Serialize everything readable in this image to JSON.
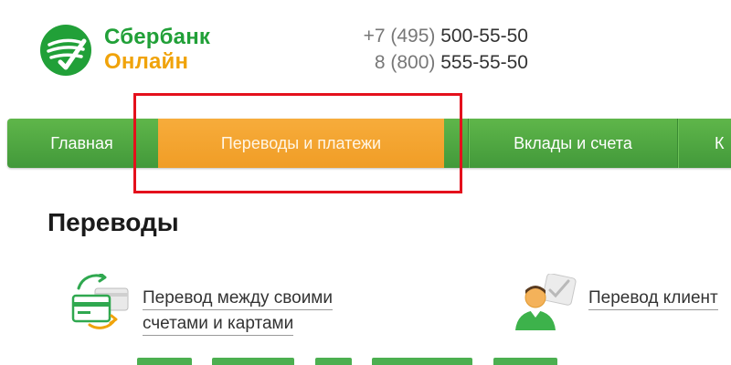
{
  "header": {
    "logo_line1": "Сбербанк",
    "logo_line2": "Онлайн",
    "phones": [
      {
        "code": "+7 (495)",
        "number": "500-55-50"
      },
      {
        "code": "8 (800)",
        "number": "555-55-50"
      }
    ]
  },
  "nav": {
    "items": [
      {
        "label": "Главная",
        "active": false
      },
      {
        "label": "Переводы и платежи",
        "active": true
      },
      {
        "label": "Вклады и счета",
        "active": false
      },
      {
        "label": "К",
        "active": false
      }
    ]
  },
  "main": {
    "title": "Переводы",
    "options": [
      {
        "line1": "Перевод между своими",
        "line2": "счетами и картами",
        "icon": "cards-transfer-icon"
      },
      {
        "line1": "Перевод клиент",
        "line2": "",
        "icon": "person-transfer-icon"
      }
    ]
  },
  "colors": {
    "brand_green": "#21a038",
    "brand_orange": "#f0a30a",
    "highlight_red": "#e4101c"
  }
}
